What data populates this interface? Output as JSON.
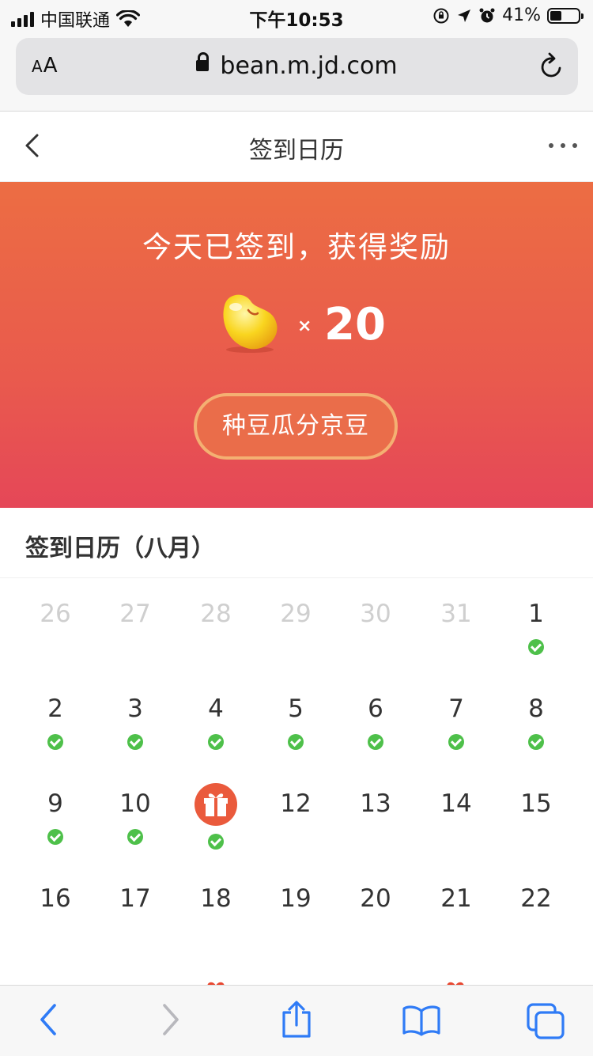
{
  "status_bar": {
    "carrier": "中国联通",
    "time": "下午10:53",
    "battery_percent": "41%",
    "battery_level": 0.41
  },
  "address_bar": {
    "text_size_label": "AA",
    "url": "bean.m.jd.com"
  },
  "header": {
    "title": "签到日历"
  },
  "banner": {
    "title": "今天已签到，获得奖励",
    "times_symbol": "×",
    "reward_amount": "20",
    "button_label": "种豆瓜分京豆"
  },
  "calendar": {
    "title": "签到日历（八月）",
    "rows": [
      [
        {
          "day": "26",
          "muted": true,
          "checked": false
        },
        {
          "day": "27",
          "muted": true,
          "checked": false
        },
        {
          "day": "28",
          "muted": true,
          "checked": false
        },
        {
          "day": "29",
          "muted": true,
          "checked": false
        },
        {
          "day": "30",
          "muted": true,
          "checked": false
        },
        {
          "day": "31",
          "muted": true,
          "checked": false
        },
        {
          "day": "1",
          "muted": false,
          "checked": true
        }
      ],
      [
        {
          "day": "2",
          "muted": false,
          "checked": true
        },
        {
          "day": "3",
          "muted": false,
          "checked": true
        },
        {
          "day": "4",
          "muted": false,
          "checked": true
        },
        {
          "day": "5",
          "muted": false,
          "checked": true
        },
        {
          "day": "6",
          "muted": false,
          "checked": true
        },
        {
          "day": "7",
          "muted": false,
          "checked": true
        },
        {
          "day": "8",
          "muted": false,
          "checked": true
        }
      ],
      [
        {
          "day": "9",
          "muted": false,
          "checked": true
        },
        {
          "day": "10",
          "muted": false,
          "checked": true
        },
        {
          "day": "",
          "muted": false,
          "checked": true,
          "icon": "gift-icon"
        },
        {
          "day": "12",
          "muted": false,
          "checked": false
        },
        {
          "day": "13",
          "muted": false,
          "checked": false
        },
        {
          "day": "14",
          "muted": false,
          "checked": false
        },
        {
          "day": "15",
          "muted": false,
          "checked": false
        }
      ],
      [
        {
          "day": "16",
          "muted": false,
          "checked": false
        },
        {
          "day": "17",
          "muted": false,
          "checked": false
        },
        {
          "day": "18",
          "muted": false,
          "checked": false
        },
        {
          "day": "19",
          "muted": false,
          "checked": false
        },
        {
          "day": "20",
          "muted": false,
          "checked": false
        },
        {
          "day": "21",
          "muted": false,
          "checked": false
        },
        {
          "day": "22",
          "muted": false,
          "checked": false
        }
      ]
    ]
  },
  "toolbar": {
    "icons": [
      "back-arrow-icon",
      "forward-arrow-icon",
      "share-icon",
      "bookmarks-icon",
      "tabs-icon"
    ]
  },
  "colors": {
    "banner_top": "#ec6d43",
    "banner_bottom": "#e54758",
    "check_green": "#4ec04a",
    "gift_red": "#ea5a3c",
    "toolbar_blue": "#2f7bf6"
  }
}
